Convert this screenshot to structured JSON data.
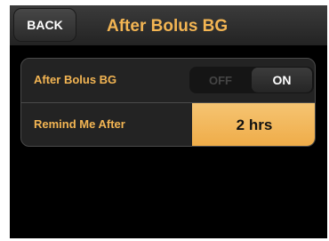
{
  "header": {
    "back_label": "BACK",
    "title": "After Bolus BG"
  },
  "settings": {
    "after_bolus_bg": {
      "label": "After Bolus BG",
      "off_label": "OFF",
      "on_label": "ON",
      "selected": "ON"
    },
    "remind_me_after": {
      "label": "Remind Me After",
      "value": "2 hrs"
    }
  },
  "colors": {
    "accent_text": "#f3b553",
    "value_highlight": "#f2b75b",
    "background": "#000000"
  }
}
